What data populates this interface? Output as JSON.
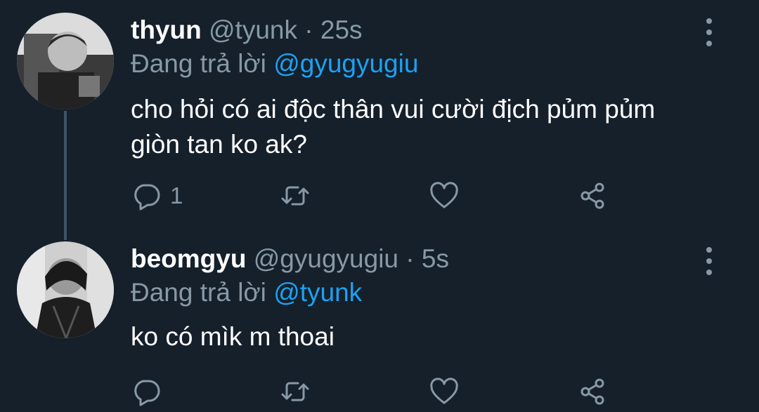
{
  "tweets": [
    {
      "name": "thyun",
      "handle": "@tyunk",
      "separator": "·",
      "time": "25s",
      "reply_prefix": "Đang trả lời",
      "reply_to": "@gyugyugiu",
      "text_line1": "cho hỏi có ai độc thân vui cười địch pủm pủm",
      "text_line2": "giòn tan ko ak?",
      "reply_count": "1",
      "avatar": "avatar-image"
    },
    {
      "name": "beomgyu",
      "handle": "@gyugyugiu",
      "separator": "·",
      "time": "5s",
      "reply_prefix": "Đang trả lời",
      "reply_to": "@tyunk",
      "text_line1": "ko có mìk m thoai",
      "reply_count": "",
      "avatar": "avatar-image"
    }
  ],
  "icons": {
    "reply": "reply-icon",
    "retweet": "retweet-icon",
    "like": "heart-icon",
    "share": "share-icon",
    "more": "more-vertical-icon"
  },
  "colors": {
    "background": "#15202b",
    "text": "#ffffff",
    "secondary": "#8899a6",
    "accent": "#1da1f2",
    "thread_line": "#3d5466"
  }
}
